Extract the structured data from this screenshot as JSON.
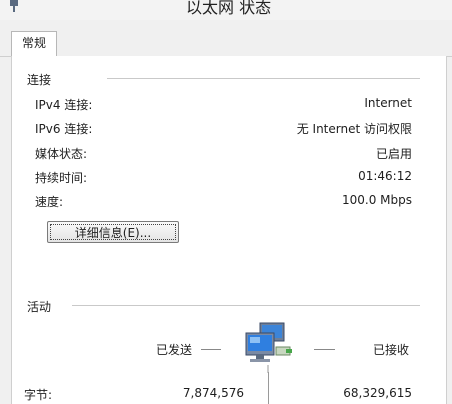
{
  "window": {
    "title": "以太网 状态"
  },
  "tabs": [
    {
      "label": "常规"
    }
  ],
  "connection": {
    "heading": "连接",
    "rows": [
      {
        "label": "IPv4 连接:",
        "value": "Internet"
      },
      {
        "label": "IPv6 连接:",
        "value": "无 Internet 访问权限"
      },
      {
        "label": "媒体状态:",
        "value": "已启用"
      },
      {
        "label": "持续时间:",
        "value": "01:46:12"
      },
      {
        "label": "速度:",
        "value": "100.0 Mbps"
      }
    ],
    "details_button": "详细信息(E)..."
  },
  "activity": {
    "heading": "活动",
    "sent_label": "已发送",
    "received_label": "已接收",
    "bytes_label": "字节:",
    "bytes_sent": "7,874,576",
    "bytes_received": "68,329,615"
  },
  "icons": {
    "window": "network-adapter-icon",
    "activity": "network-computers-icon"
  }
}
